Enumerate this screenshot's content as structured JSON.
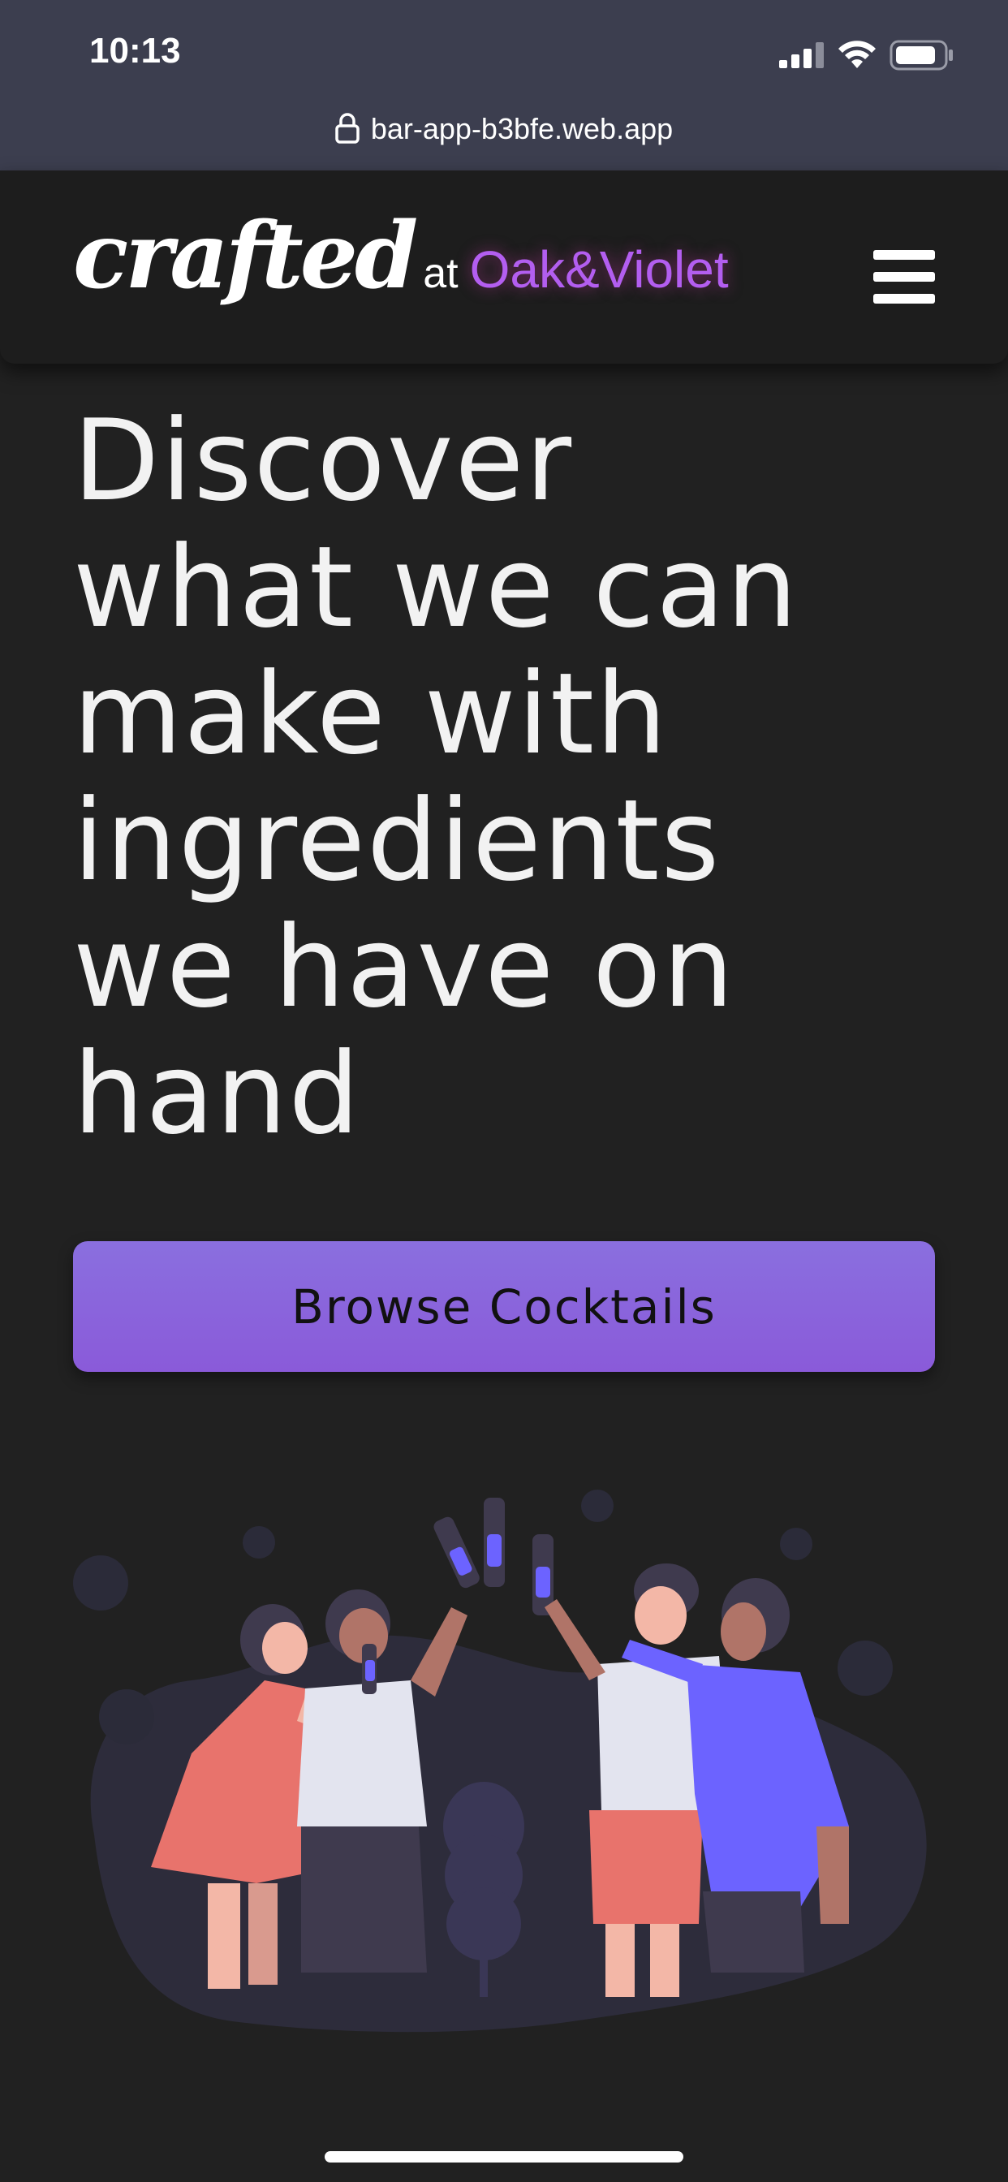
{
  "status_bar": {
    "time": "10:13",
    "icons": [
      "cellular-signal-icon",
      "wifi-icon",
      "battery-icon"
    ]
  },
  "browser": {
    "url": "bar-app-b3bfe.web.app",
    "lock_icon": "lock-icon"
  },
  "header": {
    "logo_main": "crafted",
    "logo_connector": "at",
    "logo_venue": "Oak&Violet",
    "menu_icon": "hamburger-menu-icon"
  },
  "hero": {
    "headline_lines": [
      "Discover",
      "what we can",
      "make with",
      "ingredients",
      "we have on",
      "hand"
    ],
    "cta_label": "Browse Cocktails"
  },
  "colors": {
    "background": "#212121",
    "status_bar": "#3c3e4f",
    "header": "#1d1d1d",
    "accent_purple": "#8a63dc",
    "venue_text": "#b35ef0"
  }
}
